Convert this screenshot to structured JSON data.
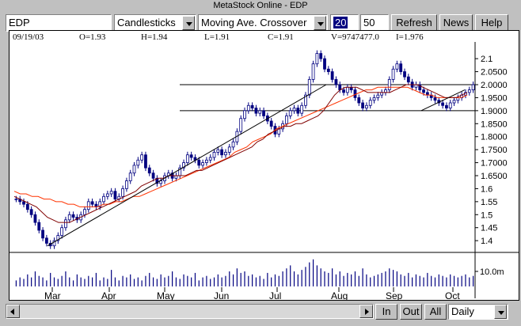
{
  "window": {
    "title": "MetaStock Online - EDP"
  },
  "toolbar": {
    "symbol_value": "EDP",
    "chart_style_value": "Candlesticks",
    "study_value": "Moving Ave. Crossover",
    "period1_value": "20",
    "period2_value": "50",
    "refresh_label": "Refresh",
    "news_label": "News",
    "help_label": "Help"
  },
  "stats": {
    "date": "09/19/03",
    "open": "O=1.93",
    "high": "H=1.94",
    "low": "L=1.91",
    "close": "C=1.91",
    "volume": "V=9747477.0",
    "indicator": "I=1.976"
  },
  "bottom": {
    "in_label": "In",
    "out_label": "Out",
    "all_label": "All",
    "interval_value": "Daily"
  },
  "colors": {
    "candles": "#000080",
    "ma_short": "#800000",
    "ma_long": "#ff3300",
    "trendline": "#000000",
    "volume": "#000080"
  },
  "chart_data": {
    "type": "candlestick",
    "x_labels": [
      "Mar",
      "Apr",
      "May",
      "Jun",
      "Jul",
      "Aug",
      "Sep",
      "Oct"
    ],
    "price_axis_ticks": [
      "1.4",
      "1.45",
      "1.5",
      "1.55",
      "1.6",
      "1.6500",
      "1.7000",
      "1.7500",
      "1.8000",
      "1.8500",
      "1.9000",
      "1.9500",
      "2.0000",
      "2.0500",
      "2.1"
    ],
    "ylim": [
      1.37,
      2.14
    ],
    "volume_axis_label": "10.0m",
    "horizontal_lines": [
      1.9,
      2.0
    ],
    "close_series": [
      1.56,
      1.55,
      1.54,
      1.52,
      1.5,
      1.47,
      1.44,
      1.41,
      1.39,
      1.38,
      1.4,
      1.42,
      1.45,
      1.48,
      1.5,
      1.49,
      1.48,
      1.5,
      1.52,
      1.55,
      1.54,
      1.53,
      1.55,
      1.57,
      1.58,
      1.59,
      1.56,
      1.57,
      1.6,
      1.63,
      1.66,
      1.69,
      1.71,
      1.73,
      1.68,
      1.66,
      1.64,
      1.62,
      1.63,
      1.65,
      1.66,
      1.64,
      1.65,
      1.68,
      1.7,
      1.73,
      1.72,
      1.71,
      1.69,
      1.7,
      1.71,
      1.72,
      1.74,
      1.75,
      1.73,
      1.74,
      1.76,
      1.78,
      1.82,
      1.87,
      1.9,
      1.92,
      1.91,
      1.89,
      1.9,
      1.88,
      1.86,
      1.84,
      1.81,
      1.83,
      1.85,
      1.88,
      1.9,
      1.91,
      1.89,
      1.92,
      1.96,
      2.02,
      2.08,
      2.12,
      2.1,
      2.06,
      2.05,
      2.02,
      2.0,
      1.98,
      1.97,
      1.99,
      1.98,
      1.95,
      1.93,
      1.91,
      1.92,
      1.94,
      1.95,
      1.96,
      1.97,
      1.98,
      2.02,
      2.06,
      2.08,
      2.05,
      2.03,
      2.01,
      1.99,
      2.0,
      1.98,
      1.97,
      1.96,
      1.95,
      1.94,
      1.93,
      1.92,
      1.91,
      1.93,
      1.94,
      1.95,
      1.96,
      1.97,
      1.98,
      2.0
    ],
    "ma_short": [
      1.57,
      1.56,
      1.55,
      1.54,
      1.53,
      1.51,
      1.49,
      1.48,
      1.47,
      1.47,
      1.47,
      1.48,
      1.49,
      1.5,
      1.51,
      1.52,
      1.53,
      1.54,
      1.55,
      1.56,
      1.57,
      1.58,
      1.59,
      1.61,
      1.62,
      1.63,
      1.64,
      1.64,
      1.65,
      1.65,
      1.65,
      1.65,
      1.66,
      1.67,
      1.67,
      1.68,
      1.69,
      1.7,
      1.71,
      1.72,
      1.73,
      1.74,
      1.75,
      1.76,
      1.78,
      1.79,
      1.81,
      1.82,
      1.83,
      1.84,
      1.84,
      1.85,
      1.85,
      1.86,
      1.87,
      1.88,
      1.9,
      1.93,
      1.96,
      1.98,
      1.99,
      1.99,
      1.99,
      1.98,
      1.97,
      1.97,
      1.97,
      1.97,
      1.97,
      1.98,
      1.99,
      2.0,
      2.0,
      2.0,
      1.99,
      1.98,
      1.97,
      1.96,
      1.95,
      1.95,
      1.95,
      1.96,
      1.97
    ],
    "ma_long": [
      1.59,
      1.58,
      1.58,
      1.57,
      1.57,
      1.56,
      1.56,
      1.55,
      1.55,
      1.54,
      1.54,
      1.53,
      1.53,
      1.53,
      1.53,
      1.54,
      1.54,
      1.55,
      1.55,
      1.56,
      1.57,
      1.57,
      1.58,
      1.59,
      1.6,
      1.61,
      1.62,
      1.63,
      1.64,
      1.65,
      1.66,
      1.67,
      1.68,
      1.69,
      1.7,
      1.71,
      1.72,
      1.74,
      1.75,
      1.76,
      1.78,
      1.79,
      1.8,
      1.81,
      1.83,
      1.84,
      1.85,
      1.86,
      1.87,
      1.88,
      1.89,
      1.9,
      1.91,
      1.92,
      1.93,
      1.94,
      1.95,
      1.96,
      1.97,
      1.98,
      1.98,
      1.99,
      1.99,
      1.99,
      1.99,
      1.99,
      1.99,
      1.98,
      1.97,
      1.96,
      1.96,
      1.95,
      1.95,
      1.95,
      1.95,
      1.95,
      1.96
    ],
    "volume_relative": [
      0.2,
      0.3,
      0.25,
      0.4,
      0.3,
      0.5,
      0.35,
      0.3,
      0.2,
      0.45,
      0.3,
      0.25,
      0.35,
      0.5,
      0.3,
      0.2,
      0.4,
      0.3,
      0.25,
      0.35,
      0.3,
      0.45,
      0.2,
      0.3,
      0.25,
      0.55,
      0.3,
      0.2,
      0.35,
      0.3,
      0.4,
      0.25,
      0.3,
      0.2,
      0.35,
      0.45,
      0.3,
      0.25,
      0.4,
      0.3,
      0.35,
      0.5,
      0.3,
      0.25,
      0.4,
      0.35,
      0.3,
      0.45,
      0.2,
      0.3,
      0.35,
      0.25,
      0.3,
      0.4,
      0.3,
      0.35,
      0.5,
      0.4,
      0.6,
      0.45,
      0.5,
      0.35,
      0.4,
      0.3,
      0.35,
      0.25,
      0.45,
      0.3,
      0.4,
      0.35,
      0.5,
      0.6,
      0.7,
      0.5,
      0.4,
      0.55,
      0.65,
      0.8,
      0.9,
      0.7,
      0.6,
      0.5,
      0.45,
      0.6,
      0.4,
      0.5,
      0.35,
      0.45,
      0.4,
      0.5,
      0.35,
      0.6,
      0.4,
      0.3,
      0.35,
      0.4,
      0.45,
      0.5,
      0.6,
      0.55,
      0.5,
      0.4,
      0.35,
      0.45,
      0.3,
      0.4,
      0.35,
      0.3,
      0.45,
      0.35,
      0.3,
      0.4,
      0.35,
      0.3,
      0.4,
      0.35,
      0.3,
      0.35,
      0.4,
      0.3,
      0.35
    ]
  }
}
